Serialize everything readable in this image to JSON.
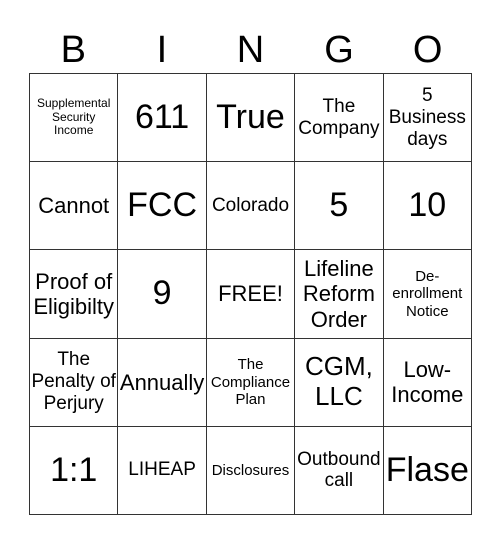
{
  "header": {
    "letters": [
      "B",
      "I",
      "N",
      "G",
      "O"
    ]
  },
  "board": {
    "cells": [
      "Supplemental Security Income",
      "611",
      "True",
      "The Company",
      "5 Business days",
      "Cannot",
      "FCC",
      "Colorado",
      "5",
      "10",
      "Proof of Eligibilty",
      "9",
      "FREE!",
      "Lifeline Reform Order",
      "De-enrollment Notice",
      "The Penalty of Perjury",
      "Annually",
      "The Compliance Plan",
      "CGM, LLC",
      "Low-Income",
      "1:1",
      "LIHEAP",
      "Disclosures",
      "Outbound call",
      "Flase"
    ]
  }
}
